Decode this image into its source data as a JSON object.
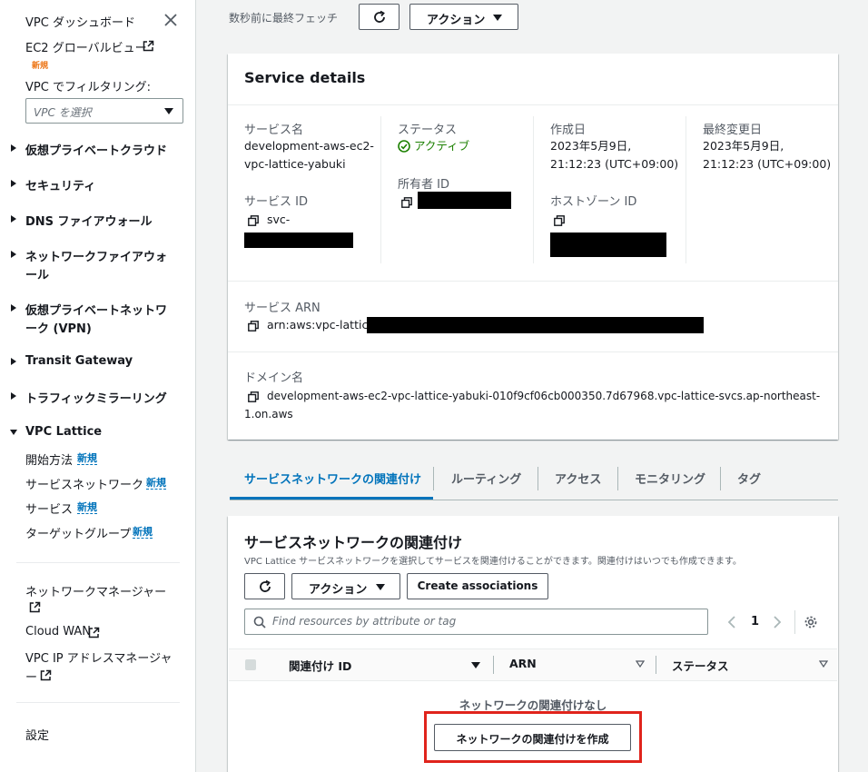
{
  "sidebar": {
    "title": "VPC ダッシュボード",
    "ec2_global_view": "EC2 グローバルビュー",
    "new_orange": "新規",
    "filter_label": "VPC でフィルタリング:",
    "filter_placeholder": "VPC を選択",
    "sections": [
      {
        "label": "仮想プライベートクラウド"
      },
      {
        "label": "セキュリティ"
      },
      {
        "label": "DNS ファイアウォール"
      },
      {
        "label_line1": "ネットワークファイアウォ",
        "label_line2": "ール"
      },
      {
        "label_line1": "仮想プライベートネットワ",
        "label_line2": "ーク (VPN)"
      },
      {
        "label": "Transit Gateway"
      },
      {
        "label": "トラフィックミラーリング"
      },
      {
        "label": "VPC Lattice"
      }
    ],
    "lattice_items": [
      {
        "label": "開始方法",
        "badge": "新規"
      },
      {
        "label": "サービスネットワーク",
        "badge": "新規"
      },
      {
        "label": "サービス",
        "badge": "新規"
      },
      {
        "label": "ターゲットグループ",
        "badge": "新規"
      }
    ],
    "network_manager": "ネットワークマネージャー",
    "cloud_wan": "Cloud WAN",
    "ipam_line1": "VPC IP アドレスマネージャ",
    "ipam_line2": "ー",
    "settings": "設定"
  },
  "topbar": {
    "fetched": "数秒前に最終フェッチ",
    "actions": "アクション"
  },
  "details": {
    "title": "Service details",
    "service_name_label": "サービス名",
    "service_name_line1": "development-aws-ec2-",
    "service_name_line2": "vpc-lattice-yabuki",
    "service_id_label": "サービス ID",
    "service_id_prefix": "svc-",
    "status_label": "ステータス",
    "status_value": "アクティブ",
    "owner_label": "所有者 ID",
    "created_label": "作成日",
    "created_line1": "2023年5月9日,",
    "created_line2": "21:12:23 (UTC+09:00)",
    "hosted_zone_label": "ホストゾーン ID",
    "modified_label": "最終変更日",
    "modified_line1": "2023年5月9日,",
    "modified_line2": "21:12:23 (UTC+09:00)",
    "arn_label": "サービス ARN",
    "arn_prefix": "arn:aws:vpc-lattice:",
    "domain_label": "ドメイン名",
    "domain_line1": "development-aws-ec2-vpc-lattice-yabuki-010f9cf06cb000350.7d67968.vpc-lattice-svcs.ap-northeast-",
    "domain_line2": "1.on.aws"
  },
  "tabs": [
    "サービスネットワークの関連付け",
    "ルーティング",
    "アクセス",
    "モニタリング",
    "タグ"
  ],
  "assoc": {
    "title": "サービスネットワークの関連付け",
    "desc": "VPC Lattice サービスネットワークを選択してサービスを関連付けることができます。関連付けはいつでも作成できます。",
    "actions": "アクション",
    "create": "Create associations",
    "search_placeholder": "Find resources by attribute or tag",
    "page": "1",
    "col_id": "関連付け ID",
    "col_arn": "ARN",
    "col_status": "ステータス",
    "empty": "ネットワークの関連付けなし",
    "create_network_assoc": "ネットワークの関連付けを作成"
  }
}
